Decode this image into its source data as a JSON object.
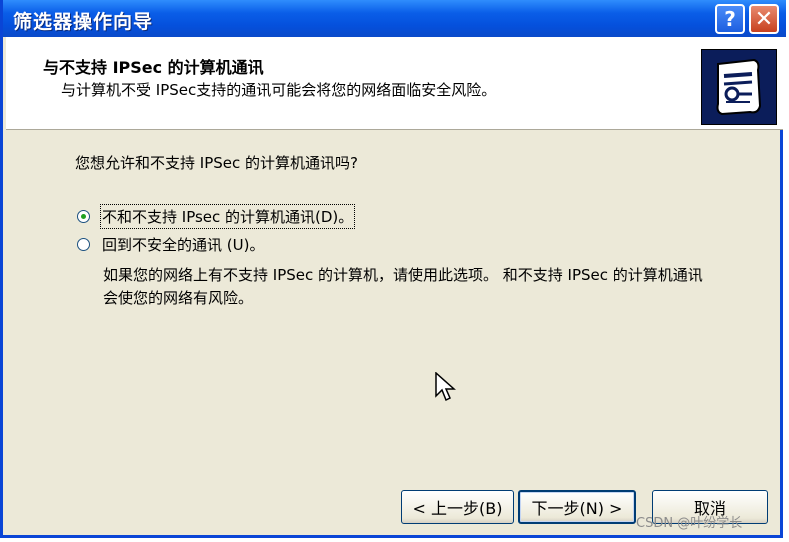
{
  "window": {
    "title": "筛选器操作向导"
  },
  "titlebar_buttons": {
    "help": "?",
    "close": "✕"
  },
  "header": {
    "title": "与不支持 IPSec 的计算机通讯",
    "subtitle": "与计算机不受 IPSec支持的通讯可能会将您的网络面临安全风险。"
  },
  "content": {
    "question": "您想允许和不支持 IPSec 的计算机通讯吗?",
    "options": [
      {
        "label": "不和不支持 IPsec 的计算机通讯(D)。",
        "checked": true
      },
      {
        "label": "回到不安全的通讯 (U)。",
        "checked": false
      }
    ],
    "description": "如果您的网络上有不支持 IPSec 的计算机，请使用此选项。 和不支持 IPSec 的计算机通讯会使您的网络有风险。"
  },
  "buttons": {
    "back": "< 上一步(B)",
    "next": "下一步(N) >",
    "cancel": "取消"
  },
  "watermark": "CSDN @叶纷学长"
}
